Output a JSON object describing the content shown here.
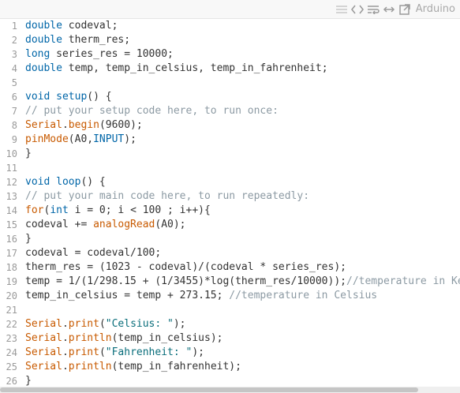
{
  "toolbar": {
    "language_label": "Arduino",
    "icons": [
      "lines-icon",
      "code-icon",
      "wrap-icon",
      "expand-icon",
      "popout-icon"
    ]
  },
  "colors": {
    "keyword": "#0066a8",
    "function": "#c85a00",
    "string": "#0a6e7b",
    "comment": "#8c9aa3",
    "text": "#333333",
    "line_number": "#9a9a9a"
  },
  "code": {
    "lines": [
      {
        "n": "1",
        "tokens": [
          {
            "t": "kw",
            "v": "double"
          },
          {
            "t": "tx",
            "v": " codeval;"
          }
        ]
      },
      {
        "n": "2",
        "tokens": [
          {
            "t": "kw",
            "v": "double"
          },
          {
            "t": "tx",
            "v": " therm_res;"
          }
        ]
      },
      {
        "n": "3",
        "tokens": [
          {
            "t": "kw",
            "v": "long"
          },
          {
            "t": "tx",
            "v": " series_res = 10000;"
          }
        ]
      },
      {
        "n": "4",
        "tokens": [
          {
            "t": "kw",
            "v": "double"
          },
          {
            "t": "tx",
            "v": " temp, temp_in_celsius, temp_in_fahrenheit;"
          }
        ]
      },
      {
        "n": "5",
        "tokens": []
      },
      {
        "n": "6",
        "tokens": [
          {
            "t": "kw",
            "v": "void"
          },
          {
            "t": "tx",
            "v": " "
          },
          {
            "t": "kw",
            "v": "setup"
          },
          {
            "t": "tx",
            "v": "() {"
          }
        ]
      },
      {
        "n": "7",
        "tokens": [
          {
            "t": "cm",
            "v": "// put your setup code here, to run once:"
          }
        ]
      },
      {
        "n": "8",
        "tokens": [
          {
            "t": "fn",
            "v": "Serial"
          },
          {
            "t": "tx",
            "v": "."
          },
          {
            "t": "fn",
            "v": "begin"
          },
          {
            "t": "tx",
            "v": "(9600);"
          }
        ]
      },
      {
        "n": "9",
        "tokens": [
          {
            "t": "fn",
            "v": "pinMode"
          },
          {
            "t": "tx",
            "v": "(A0,"
          },
          {
            "t": "kw",
            "v": "INPUT"
          },
          {
            "t": "tx",
            "v": ");"
          }
        ]
      },
      {
        "n": "10",
        "tokens": [
          {
            "t": "tx",
            "v": "}"
          }
        ]
      },
      {
        "n": "11",
        "tokens": []
      },
      {
        "n": "12",
        "tokens": [
          {
            "t": "kw",
            "v": "void"
          },
          {
            "t": "tx",
            "v": " "
          },
          {
            "t": "kw",
            "v": "loop"
          },
          {
            "t": "tx",
            "v": "() {"
          }
        ]
      },
      {
        "n": "13",
        "tokens": [
          {
            "t": "cm",
            "v": "// put your main code here, to run repeatedly:"
          }
        ]
      },
      {
        "n": "14",
        "tokens": [
          {
            "t": "fn",
            "v": "for"
          },
          {
            "t": "tx",
            "v": "("
          },
          {
            "t": "kw",
            "v": "int"
          },
          {
            "t": "tx",
            "v": " i = 0; i < 100 ; i++){"
          }
        ]
      },
      {
        "n": "15",
        "tokens": [
          {
            "t": "tx",
            "v": "codeval += "
          },
          {
            "t": "fn",
            "v": "analogRead"
          },
          {
            "t": "tx",
            "v": "(A0);"
          }
        ]
      },
      {
        "n": "16",
        "tokens": [
          {
            "t": "tx",
            "v": "}"
          }
        ]
      },
      {
        "n": "17",
        "tokens": [
          {
            "t": "tx",
            "v": "codeval = codeval/100;"
          }
        ]
      },
      {
        "n": "18",
        "tokens": [
          {
            "t": "tx",
            "v": "therm_res = (1023 - codeval)/(codeval * series_res);"
          }
        ]
      },
      {
        "n": "19",
        "tokens": [
          {
            "t": "tx",
            "v": "temp = 1/(1/298.15 + (1/3455)*log(therm_res/10000));"
          },
          {
            "t": "cm",
            "v": "//temperature in Kelvin"
          }
        ]
      },
      {
        "n": "20",
        "tokens": [
          {
            "t": "tx",
            "v": "temp_in_celsius = temp + 273.15; "
          },
          {
            "t": "cm",
            "v": "//temperature in Celsius"
          }
        ]
      },
      {
        "n": "21",
        "tokens": []
      },
      {
        "n": "22",
        "tokens": [
          {
            "t": "fn",
            "v": "Serial"
          },
          {
            "t": "tx",
            "v": "."
          },
          {
            "t": "fn",
            "v": "print"
          },
          {
            "t": "tx",
            "v": "("
          },
          {
            "t": "str",
            "v": "\"Celsius: \""
          },
          {
            "t": "tx",
            "v": ");"
          }
        ]
      },
      {
        "n": "23",
        "tokens": [
          {
            "t": "fn",
            "v": "Serial"
          },
          {
            "t": "tx",
            "v": "."
          },
          {
            "t": "fn",
            "v": "println"
          },
          {
            "t": "tx",
            "v": "(temp_in_celsius);"
          }
        ]
      },
      {
        "n": "24",
        "tokens": [
          {
            "t": "fn",
            "v": "Serial"
          },
          {
            "t": "tx",
            "v": "."
          },
          {
            "t": "fn",
            "v": "print"
          },
          {
            "t": "tx",
            "v": "("
          },
          {
            "t": "str",
            "v": "\"Fahrenheit: \""
          },
          {
            "t": "tx",
            "v": ");"
          }
        ]
      },
      {
        "n": "25",
        "tokens": [
          {
            "t": "fn",
            "v": "Serial"
          },
          {
            "t": "tx",
            "v": "."
          },
          {
            "t": "fn",
            "v": "println"
          },
          {
            "t": "tx",
            "v": "(temp_in_fahrenheit);"
          }
        ]
      },
      {
        "n": "26",
        "tokens": [
          {
            "t": "tx",
            "v": "}"
          }
        ]
      }
    ]
  }
}
